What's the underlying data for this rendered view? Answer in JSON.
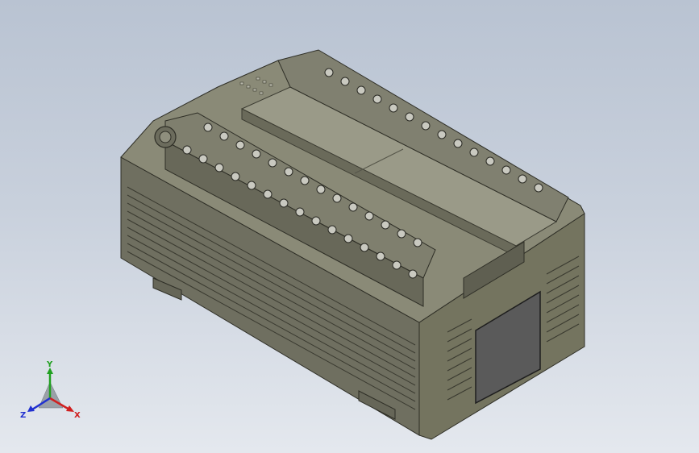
{
  "viewport": {
    "background_top": "#b9c3d2",
    "background_bottom": "#e4e8ee"
  },
  "model": {
    "body_color": "#7d7d6c",
    "top_color": "#8c8c79",
    "front_color": "#6f6f5f",
    "terminal_screw_count_front": 15,
    "terminal_screw_count_back": 14
  },
  "triad": {
    "x_label": "X",
    "y_label": "Y",
    "z_label": "Z",
    "x_color": "#d02020",
    "y_color": "#20a020",
    "z_color": "#2030d0"
  }
}
